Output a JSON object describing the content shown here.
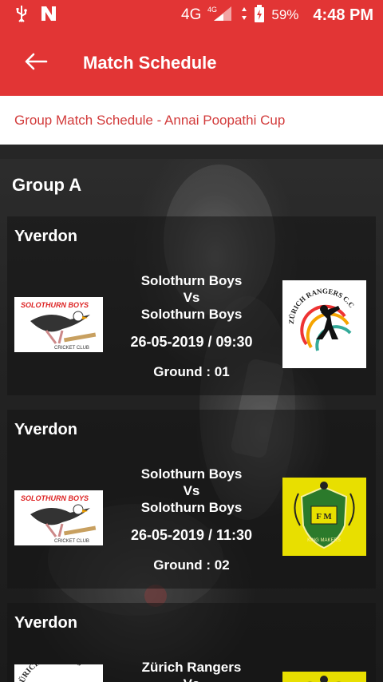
{
  "status_bar": {
    "network": "4G",
    "network_small": "4G",
    "battery_percent": "59%",
    "time": "4:48 PM"
  },
  "app_bar": {
    "title": "Match Schedule"
  },
  "subheader": {
    "text": "Group Match Schedule - Annai Poopathi Cup"
  },
  "group": {
    "title": "Group A"
  },
  "matches": [
    {
      "venue": "Yverdon",
      "team1": "Solothurn Boys",
      "vs": "Vs",
      "team2": "Solothurn Boys",
      "datetime": "26-05-2019 / 09:30",
      "ground": "Ground : 01",
      "left_logo_text": "SOLOTHURN BOYS",
      "left_logo_sub": "CRICKET CLUB",
      "right_logo_text": "ZÜRICH RANGERS C.C"
    },
    {
      "venue": "Yverdon",
      "team1": "Solothurn Boys",
      "vs": "Vs",
      "team2": "Solothurn Boys",
      "datetime": "26-05-2019 / 11:30",
      "ground": "Ground : 02",
      "left_logo_text": "SOLOTHURN BOYS",
      "left_logo_sub": "CRICKET CLUB",
      "right_logo_text": "F M",
      "right_logo_sub": "KING MAKERS"
    },
    {
      "venue": "Yverdon",
      "team1": "Zürich Rangers",
      "vs": "Vs",
      "left_logo_text": "ZÜRICH RANGERS"
    }
  ],
  "colors": {
    "primary_red": "#e23535",
    "subheader_text": "#d23a3a"
  }
}
